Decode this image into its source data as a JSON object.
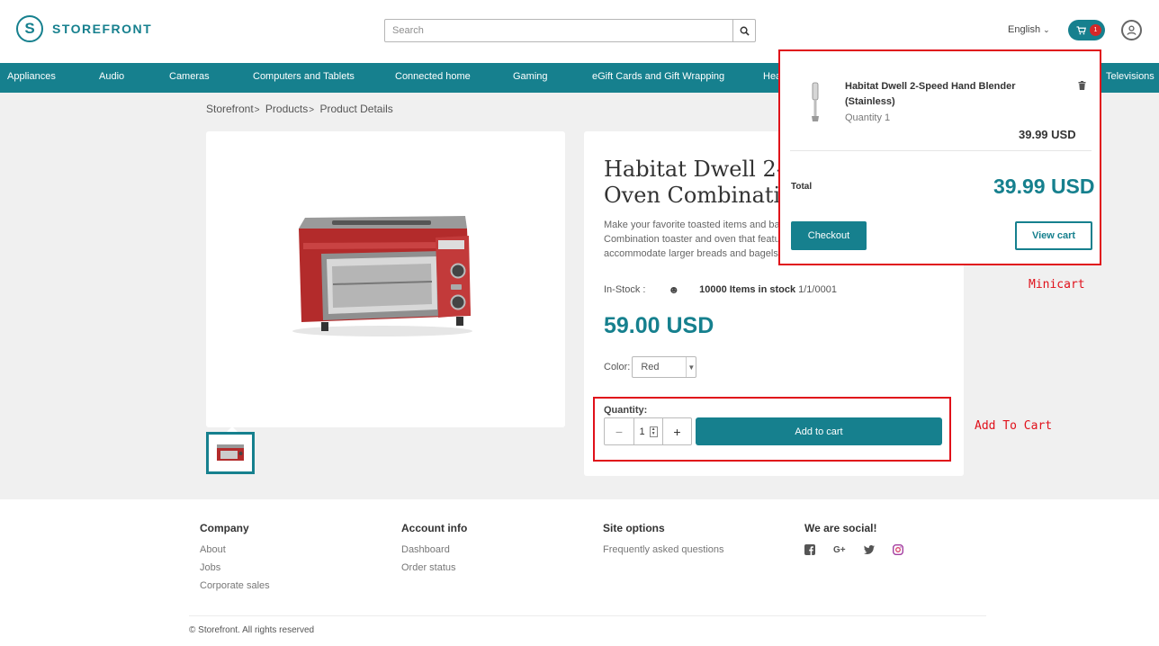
{
  "header": {
    "logo_text": "STOREFRONT",
    "search_placeholder": "Search",
    "language": "English",
    "cart_count": "1"
  },
  "nav": {
    "items": [
      "Appliances",
      "Audio",
      "Cameras",
      "Computers and Tablets",
      "Connected home",
      "Gaming",
      "eGift Cards and Gift Wrapping",
      "Hea",
      "Televisions"
    ]
  },
  "breadcrumb": [
    "Storefront",
    "Products",
    "Product Details"
  ],
  "product": {
    "title": "Habitat Dwell 2-S\nOven Combinatio",
    "description": "Make your favorite toasted items and bake\nCombination toaster and oven that feature\naccommodate larger breads and bagels.",
    "stock_label": "In-Stock :",
    "stock_count": "10000 Items in stock",
    "stock_date": "1/1/0001",
    "price": "59.00 USD",
    "color_label": "Color:",
    "color_value": "Red",
    "quantity_label": "Quantity:",
    "quantity_value": "1",
    "add_to_cart": "Add to cart"
  },
  "minicart": {
    "item_name": "Habitat Dwell 2-Speed Hand Blender (Stainless)",
    "item_quantity": "Quantity 1",
    "item_price": "39.99 USD",
    "total_label": "Total",
    "total": "39.99 USD",
    "checkout": "Checkout",
    "view_cart": "View cart"
  },
  "annotations": {
    "minicart": "Minicart",
    "add_to_cart": "Add To Cart"
  },
  "footer": {
    "company": {
      "title": "Company",
      "links": [
        "About",
        "Jobs",
        "Corporate sales"
      ]
    },
    "account": {
      "title": "Account info",
      "links": [
        "Dashboard",
        "Order status"
      ]
    },
    "site": {
      "title": "Site options",
      "links": [
        "Frequently asked questions"
      ]
    },
    "social": {
      "title": "We are social!",
      "icons": [
        "facebook-icon",
        "google-plus-icon",
        "twitter-icon",
        "instagram-icon"
      ]
    },
    "copyright": "© Storefront. All rights reserved"
  },
  "colors": {
    "accent": "#16808e",
    "annotation": "#e0101a",
    "badge": "#d62828"
  }
}
